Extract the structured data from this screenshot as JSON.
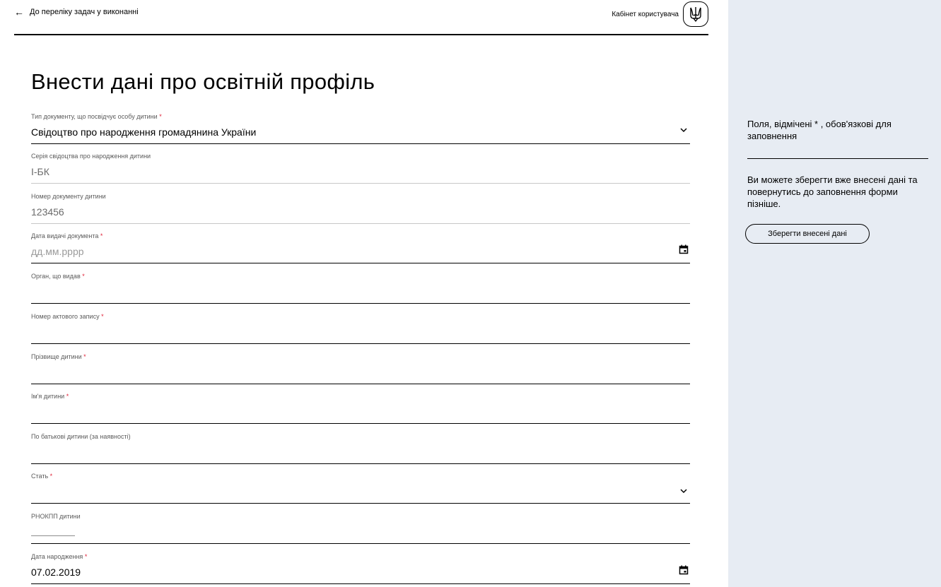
{
  "header": {
    "back_label": "До переліку задач у виконанні",
    "cabinet_label": "Кабінет користувача"
  },
  "page": {
    "title": "Внести дані про освітній профіль"
  },
  "form": {
    "required_mark": "*",
    "fields": [
      {
        "label": "Тип документу, що посвідчує особу дитини",
        "value": "Свідоцтво про народження громадянина України"
      },
      {
        "label": "Серія свідоцтва про народження дитини",
        "value": "І-БК"
      },
      {
        "label": "Номер документу дитини",
        "value": "123456"
      },
      {
        "label": "Дата видачі документа",
        "placeholder": "дд.мм.рррр"
      },
      {
        "label": "Орган, що видав"
      },
      {
        "label": "Номер актового запису"
      },
      {
        "label": "Прізвище дитини"
      },
      {
        "label": "Ім'я дитини"
      },
      {
        "label": "По батькові дитини (за наявності)"
      },
      {
        "label": "Стать"
      },
      {
        "label": "РНОКПП дитини"
      },
      {
        "label": "Дата народження",
        "value": "07.02.2019"
      }
    ]
  },
  "aside": {
    "required_note": "Поля, відмічені * , обов'язкові для заповнення",
    "save_note": "Ви можете зберегти вже внесені дані та повернутись до заповнення форми пізніше.",
    "save_button": "Зберегти внесені дані"
  },
  "colors": {
    "required": "#e0243a",
    "sidebar_bg": "#e7ecf3"
  },
  "icons": {
    "back": "arrow-left-icon",
    "emblem": "trident-icon",
    "select": "chevron-down-icon",
    "date": "calendar-icon"
  }
}
